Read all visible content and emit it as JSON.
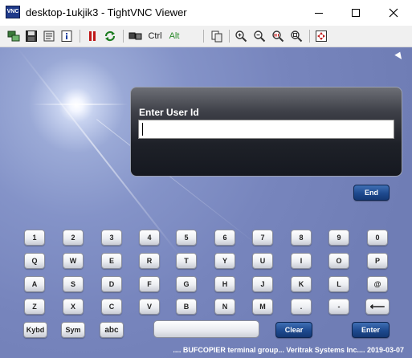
{
  "window": {
    "title": "desktop-1ukjik3 - TightVNC Viewer",
    "app_icon_text": "VNC"
  },
  "toolbar": {
    "icons": [
      "new-connection-icon",
      "save-icon",
      "options-icon",
      "info-icon",
      "pause-icon",
      "refresh-icon",
      "send-keys-icon",
      "ctrl-toggle",
      "alt-toggle",
      "clipboard-icon",
      "zoom-in-icon",
      "zoom-out-icon",
      "zoom-100-icon",
      "zoom-auto-icon",
      "fullscreen-icon"
    ],
    "ctrl_label": "Ctrl",
    "alt_label": "Alt"
  },
  "login": {
    "label": "Enter User Id",
    "value": ""
  },
  "end_button": "End",
  "keyboard": {
    "row1": [
      "1",
      "2",
      "3",
      "4",
      "5",
      "6",
      "7",
      "8",
      "9",
      "0"
    ],
    "row2": [
      "Q",
      "W",
      "E",
      "R",
      "T",
      "Y",
      "U",
      "I",
      "O",
      "P"
    ],
    "row3": [
      "A",
      "S",
      "D",
      "F",
      "G",
      "H",
      "J",
      "K",
      "L",
      "@"
    ],
    "row4": [
      "Z",
      "X",
      "C",
      "V",
      "B",
      "N",
      "M",
      ".",
      "-",
      "⟵"
    ],
    "kybd": "Kybd",
    "sym": "Sym",
    "abc": "abc",
    "clear": "Clear",
    "enter": "Enter"
  },
  "status": ".... BUFCOPIER terminal group...  Veritrak Systems Inc....  2019-03-07",
  "colors": {
    "background": "#7785bd",
    "panel": "#1e2128",
    "blue_button": "#1e4a8f"
  }
}
